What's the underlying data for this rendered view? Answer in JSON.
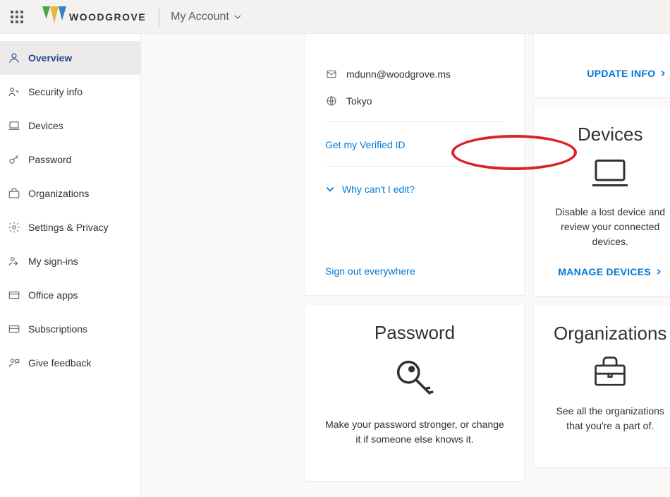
{
  "header": {
    "brand": "WOODGROVE",
    "page_title": "My Account"
  },
  "sidebar": {
    "items": [
      {
        "label": "Overview",
        "icon": "user"
      },
      {
        "label": "Security info",
        "icon": "key-user"
      },
      {
        "label": "Devices",
        "icon": "laptop"
      },
      {
        "label": "Password",
        "icon": "key"
      },
      {
        "label": "Organizations",
        "icon": "briefcase"
      },
      {
        "label": "Settings & Privacy",
        "icon": "gear"
      },
      {
        "label": "My sign-ins",
        "icon": "signin"
      },
      {
        "label": "Office apps",
        "icon": "apps"
      },
      {
        "label": "Subscriptions",
        "icon": "card"
      },
      {
        "label": "Give feedback",
        "icon": "feedback"
      }
    ]
  },
  "profile_card": {
    "email": "mdunn@woodgrove.ms",
    "location": "Tokyo",
    "verified_id_label": "Get my Verified ID",
    "why_cant_edit_label": "Why can't I edit?",
    "signout_label": "Sign out everywhere"
  },
  "update_info_card": {
    "link_label": "UPDATE INFO"
  },
  "devices_card": {
    "title": "Devices",
    "description": "Disable a lost device and review your connected devices.",
    "link_label": "MANAGE DEVICES"
  },
  "password_card": {
    "title": "Password",
    "description": "Make your password stronger, or change it if someone else knows it."
  },
  "organizations_card": {
    "title": "Organizations",
    "description": "See all the organizations that you're a part of."
  }
}
